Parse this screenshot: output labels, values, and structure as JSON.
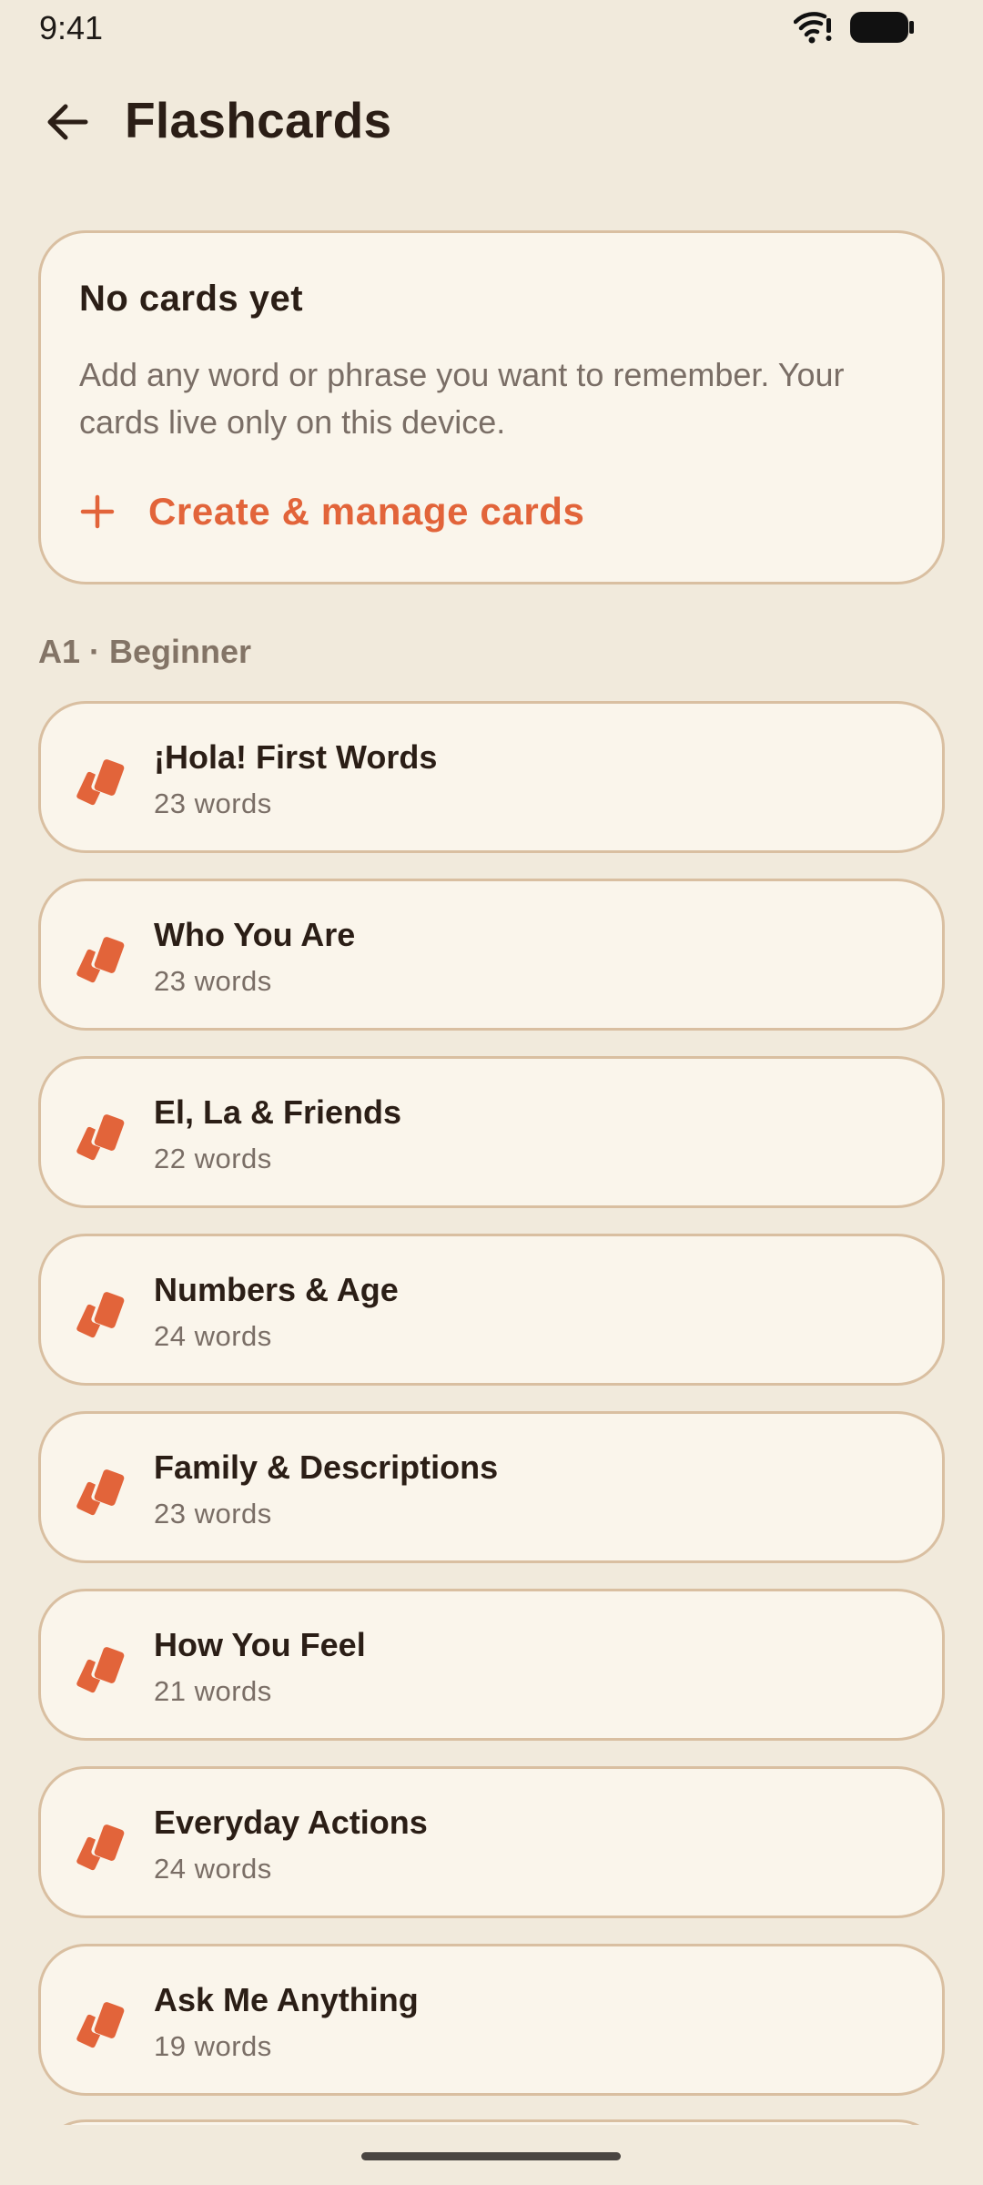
{
  "status_bar": {
    "time": "9:41",
    "wifi_icon": "wifi-icon",
    "battery_icon": "battery-icon"
  },
  "app_bar": {
    "back_icon": "arrow-left-icon",
    "title": "Flashcards"
  },
  "empty_state": {
    "title": "No cards yet",
    "body": "Add any word or phrase you want to remember. Your cards live only on this device.",
    "action_icon": "plus-icon",
    "action_label": "Create & manage cards"
  },
  "section": {
    "label": "A1 · Beginner"
  },
  "decks": [
    {
      "name": "¡Hola! First Words",
      "count": "23 words"
    },
    {
      "name": "Who You Are",
      "count": "23 words"
    },
    {
      "name": "El, La & Friends",
      "count": "22 words"
    },
    {
      "name": "Numbers & Age",
      "count": "24 words"
    },
    {
      "name": "Family & Descriptions",
      "count": "23 words"
    },
    {
      "name": "How You Feel",
      "count": "21 words"
    },
    {
      "name": "Everyday Actions",
      "count": "24 words"
    },
    {
      "name": "Ask Me Anything",
      "count": "19 words"
    }
  ],
  "deck_icon": "flashcards-deck-icon",
  "colors": {
    "background": "#F1EADC",
    "card": "#FAF5EB",
    "card_border": "#D9BFA1",
    "accent": "#E2643A",
    "text_primary": "#2B1E16",
    "text_secondary": "#7A6E66"
  }
}
